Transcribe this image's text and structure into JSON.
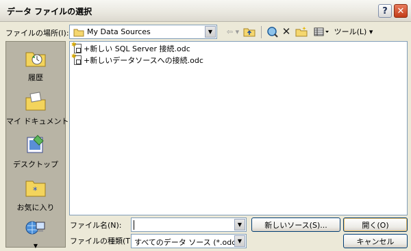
{
  "window": {
    "title": "データ ファイルの選択",
    "help_label": "?",
    "close_label": "✕"
  },
  "toolbar": {
    "look_in_label": "ファイルの場所(I):",
    "look_in_value": "My Data Sources",
    "tools_label": "ツール(L)",
    "icons": [
      "back-icon",
      "up-folder-icon",
      "search-web-icon",
      "delete-icon",
      "new-folder-icon",
      "views-icon"
    ]
  },
  "places": [
    {
      "label": "履歴",
      "icon": "history-icon"
    },
    {
      "label": "マイ ドキュメント",
      "icon": "my-documents-icon"
    },
    {
      "label": "デスクトップ",
      "icon": "desktop-icon"
    },
    {
      "label": "お気に入り",
      "icon": "favorites-icon"
    },
    {
      "label": "",
      "icon": "network-places-icon"
    }
  ],
  "files": [
    {
      "name": "+新しい SQL Server 接続.odc",
      "icon": "odc-file-icon"
    },
    {
      "name": "+新しいデータソースへの接続.odc",
      "icon": "odc-file-icon"
    }
  ],
  "bottom": {
    "file_name_label": "ファイル名(N):",
    "file_name_value": "",
    "file_type_label": "ファイルの種類(T):",
    "file_type_value": "すべてのデータ ソース (*.odc;*.m",
    "new_source_button": "新しいソース(S)...",
    "open_button": "開く(O)",
    "cancel_button": "キャンセル"
  },
  "colors": {
    "dialog_bg": "#ece9d8",
    "places_bg": "#b8b4a5",
    "close_button": "#c33c18",
    "input_border": "#7f9db9"
  }
}
